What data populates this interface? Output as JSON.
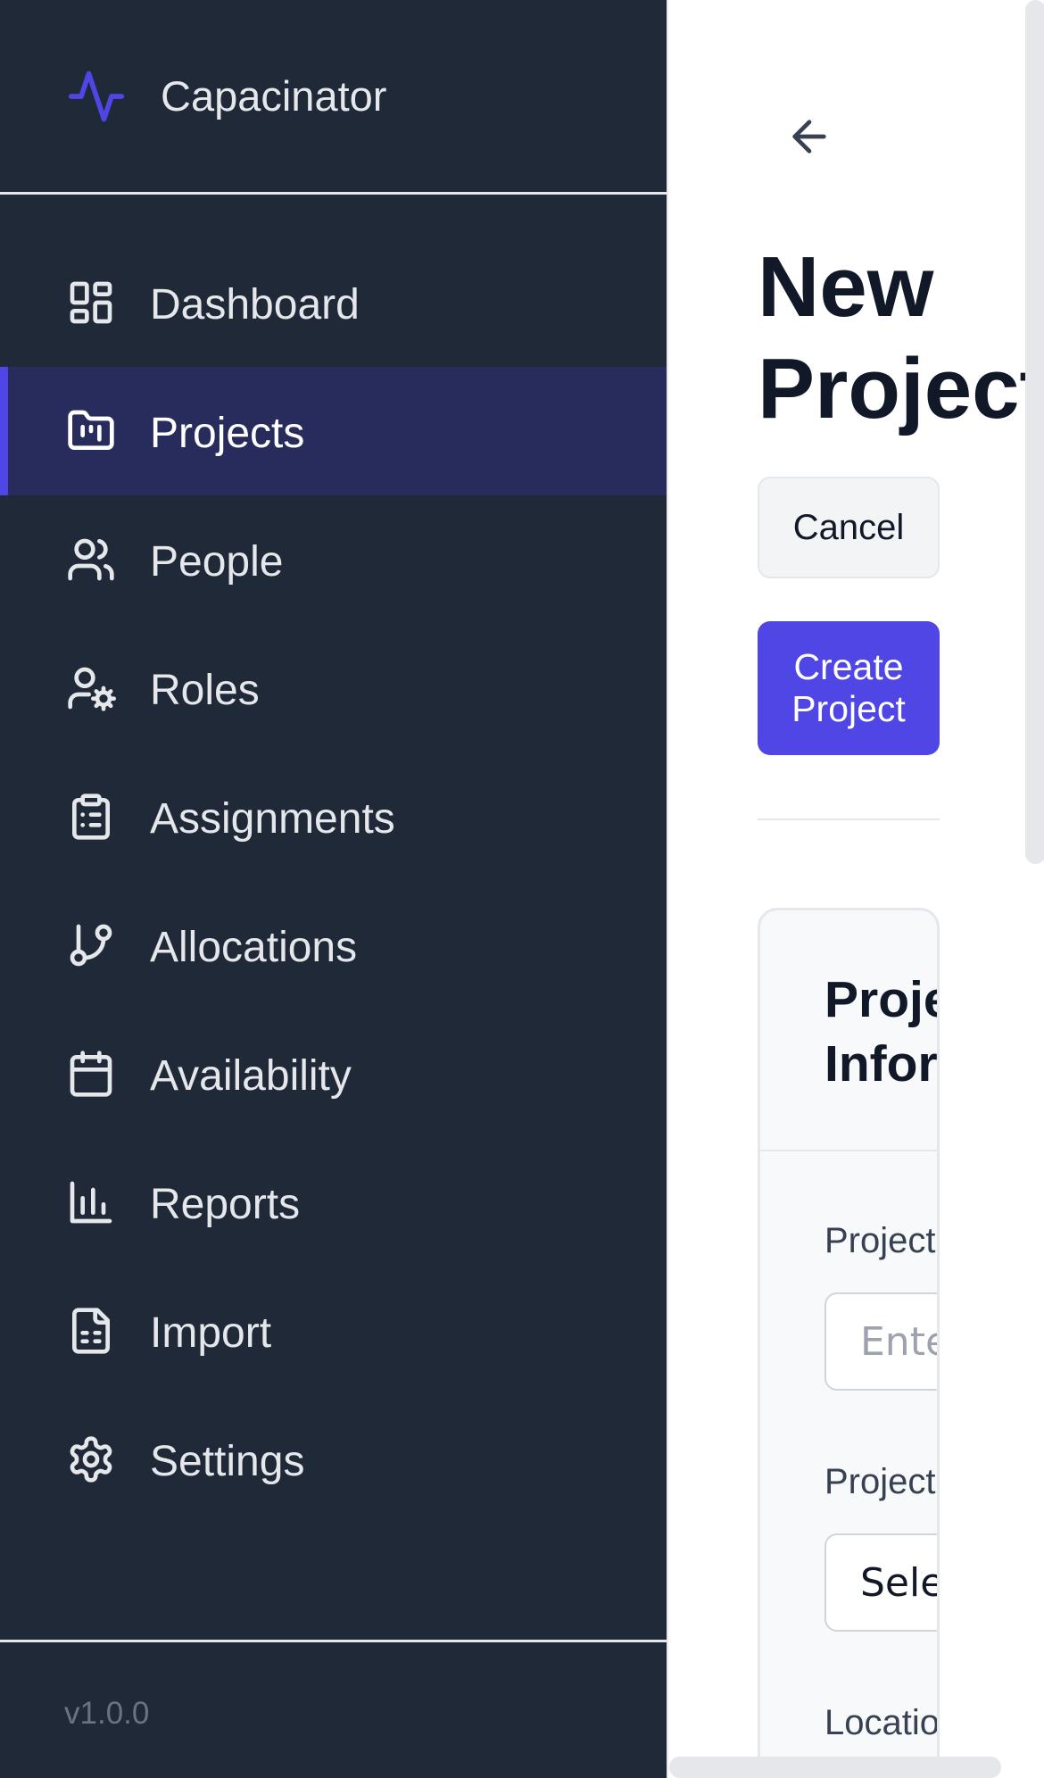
{
  "app": {
    "name": "Capacinator",
    "version": "v1.0.0",
    "accent": "#4f46e5"
  },
  "sidebar": {
    "items": [
      {
        "label": "Dashboard",
        "icon": "dashboard-icon",
        "active": false
      },
      {
        "label": "Projects",
        "icon": "folder-kanban-icon",
        "active": true
      },
      {
        "label": "People",
        "icon": "users-icon",
        "active": false
      },
      {
        "label": "Roles",
        "icon": "user-cog-icon",
        "active": false
      },
      {
        "label": "Assignments",
        "icon": "clipboard-list-icon",
        "active": false
      },
      {
        "label": "Allocations",
        "icon": "git-branch-icon",
        "active": false
      },
      {
        "label": "Availability",
        "icon": "calendar-icon",
        "active": false
      },
      {
        "label": "Reports",
        "icon": "bar-chart-icon",
        "active": false
      },
      {
        "label": "Import",
        "icon": "file-spreadsheet-icon",
        "active": false
      },
      {
        "label": "Settings",
        "icon": "gear-icon",
        "active": false
      }
    ]
  },
  "page": {
    "title": "New\nProject",
    "cancel_label": "Cancel",
    "create_label": "Create\nProject"
  },
  "card": {
    "title": "Project\nInformation",
    "fields": {
      "project_name": {
        "label": "Project",
        "placeholder": "Ente"
      },
      "project_type": {
        "label": "Project",
        "value": "Selec"
      },
      "location": {
        "label": "Locatio"
      }
    }
  }
}
